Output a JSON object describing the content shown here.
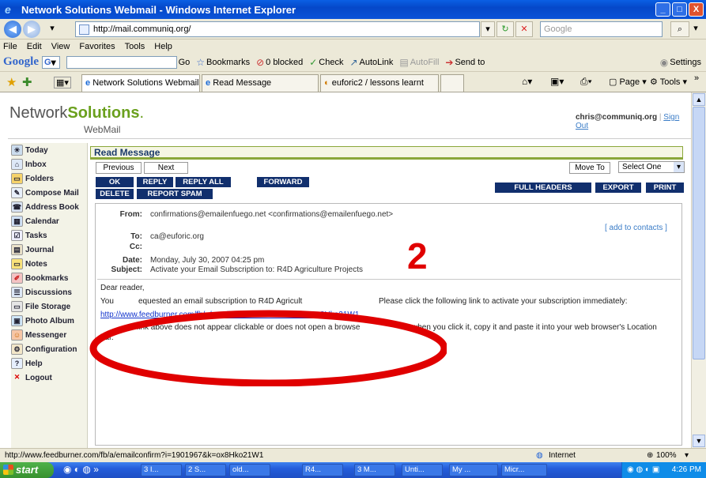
{
  "window": {
    "title": "Network Solutions Webmail - Windows Internet Explorer",
    "buttons": {
      "minimize": "_",
      "maximize": "□",
      "close": "X"
    }
  },
  "address_bar": {
    "url": "http://mail.communiq.org/",
    "search_placeholder": "Google"
  },
  "menu": [
    "File",
    "Edit",
    "View",
    "Favorites",
    "Tools",
    "Help"
  ],
  "google_toolbar": {
    "logo": "Google",
    "logo_g": "G",
    "go": "Go",
    "bookmarks": "Bookmarks",
    "blocked": "0 blocked",
    "check": "Check",
    "autolink": "AutoLink",
    "autofill": "AutoFill",
    "send_to": "Send to",
    "settings": "Settings"
  },
  "tabs": [
    {
      "label": "Network Solutions Webmail",
      "active": true
    },
    {
      "label": "Read Message",
      "active": false
    },
    {
      "label": "euforic2 / lessons learnt",
      "active": false
    }
  ],
  "tab_tools": {
    "page": "Page",
    "tools": "Tools"
  },
  "webmail": {
    "logo_left": "Network",
    "logo_right": "Solutions",
    "logo_sub": "WebMail",
    "user": "chris@communiq.org",
    "sign_out": "Sign Out"
  },
  "nav": [
    {
      "label": "Today",
      "icon": "calendar-today-icon"
    },
    {
      "label": "Inbox",
      "icon": "inbox-icon"
    },
    {
      "label": "Folders",
      "icon": "folder-icon"
    },
    {
      "label": "Compose Mail",
      "icon": "compose-icon"
    },
    {
      "label": "Address Book",
      "icon": "address-book-icon"
    },
    {
      "label": "Calendar",
      "icon": "calendar-icon"
    },
    {
      "label": "Tasks",
      "icon": "tasks-icon"
    },
    {
      "label": "Journal",
      "icon": "journal-icon"
    },
    {
      "label": "Notes",
      "icon": "notes-icon"
    },
    {
      "label": "Bookmarks",
      "icon": "bookmark-icon"
    },
    {
      "label": "Discussions",
      "icon": "discussions-icon"
    },
    {
      "label": "File Storage",
      "icon": "file-storage-icon"
    },
    {
      "label": "Photo Album",
      "icon": "photo-album-icon"
    },
    {
      "label": "Messenger",
      "icon": "messenger-icon"
    },
    {
      "label": "Configuration",
      "icon": "configuration-icon"
    },
    {
      "label": "Help",
      "icon": "help-icon"
    },
    {
      "label": "Logout",
      "icon": "logout-icon"
    }
  ],
  "read_message": {
    "heading": "Read Message",
    "previous": "Previous",
    "next": "Next",
    "move_to": "Move To",
    "move_select": "Select One",
    "ok": "OK",
    "reply": "REPLY",
    "reply_all": "REPLY ALL",
    "forward": "FORWARD",
    "delete": "DELETE",
    "report_spam": "REPORT SPAM",
    "full_headers": "FULL HEADERS",
    "export": "EXPORT",
    "print": "PRINT"
  },
  "message": {
    "from_label": "From:",
    "from": "confirmations@emailenfuego.net <confirmations@emailenfuego.net>",
    "add_contacts": "[ add to contacts ]",
    "to_label": "To:",
    "to": "ca@euforic.org",
    "cc_label": "Cc:",
    "cc": "",
    "date_label": "Date:",
    "date": "Monday, July 30, 2007 04:25 pm",
    "subject_label": "Subject:",
    "subject": "Activate your Email Subscription to: R4D Agriculture Projects",
    "body_greeting": "Dear reader,",
    "body_line1a": "You",
    "body_line1b": "equested an email subscription to R4D Agricult",
    "body_line1c": "Please click the following link to activate your subscription immediately:",
    "body_link": "http://www.feedburner.com/fb/a/emailconfirm?i=1901967&k=ox8Hko21W1",
    "body_line2a": "link above does not appear clickable or does not open a browse",
    "body_line2b": "when you click it, copy it and paste it into your web browser's Location",
    "body_line3": "bar."
  },
  "annotation": {
    "number": "2",
    "color": "#e00000"
  },
  "status_bar": {
    "url": "http://www.feedburner.com/fb/a/emailconfirm?i=1901967&k=ox8Hko21W1",
    "zone": "Internet",
    "zoom": "100%"
  },
  "taskbar": {
    "start": "start",
    "tasks": [
      "3 I...",
      "2 S...",
      "old...",
      "R4...",
      "3 M...",
      "Unti...",
      "My ...",
      "Micr..."
    ],
    "clock": "4:26 PM"
  }
}
